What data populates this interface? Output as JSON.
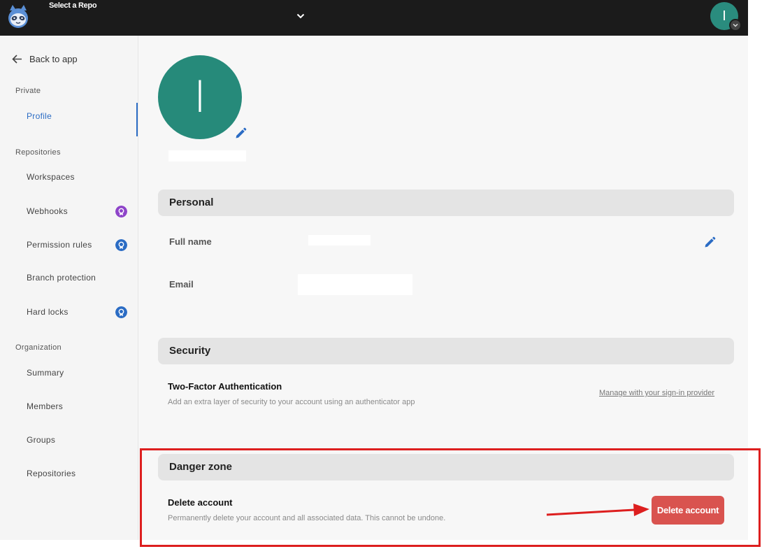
{
  "header": {
    "repo_selector_label": "Select a Repo",
    "user_initial": "I"
  },
  "sidebar": {
    "back_label": "Back to app",
    "sections": {
      "private": "Private",
      "repositories": "Repositories",
      "organization": "Organization"
    },
    "items": {
      "profile": "Profile",
      "workspaces": "Workspaces",
      "webhooks": "Webhooks",
      "permission_rules": "Permission rules",
      "branch_protection": "Branch protection",
      "hard_locks": "Hard locks",
      "summary": "Summary",
      "members": "Members",
      "groups": "Groups",
      "repositories": "Repositories"
    }
  },
  "profile": {
    "avatar_initial": "I",
    "personal": {
      "title": "Personal",
      "full_name_label": "Full name",
      "email_label": "Email"
    },
    "security": {
      "title": "Security",
      "tfa_title": "Two-Factor Authentication",
      "tfa_desc": "Add an extra layer of security to your account using an authenticator app",
      "manage_link": "Manage with your sign-in provider"
    },
    "danger": {
      "title": "Danger zone",
      "delete_title": "Delete account",
      "delete_desc": "Permanently delete your account and all associated data. This cannot be undone.",
      "delete_button": "Delete account"
    }
  },
  "colors": {
    "accent": "#2b6cc4",
    "avatar": "#268a7a",
    "danger": "#d9534f",
    "highlight": "#dd1f1f",
    "badge_purple": "#8e44c9",
    "badge_blue": "#2b6cc4"
  }
}
